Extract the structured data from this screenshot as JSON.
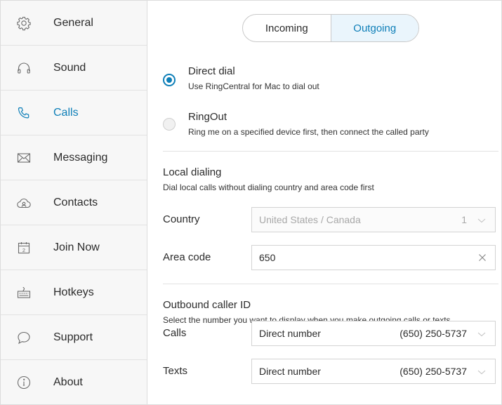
{
  "sidebar": {
    "items": [
      {
        "label": "General",
        "icon": "gear-icon",
        "active": false
      },
      {
        "label": "Sound",
        "icon": "headphones-icon",
        "active": false
      },
      {
        "label": "Calls",
        "icon": "phone-icon",
        "active": true
      },
      {
        "label": "Messaging",
        "icon": "envelope-icon",
        "active": false
      },
      {
        "label": "Contacts",
        "icon": "cloud-contacts-icon",
        "active": false
      },
      {
        "label": "Join Now",
        "icon": "calendar-icon",
        "active": false
      },
      {
        "label": "Hotkeys",
        "icon": "keyboard-icon",
        "active": false
      },
      {
        "label": "Support",
        "icon": "chat-bubble-icon",
        "active": false
      },
      {
        "label": "About",
        "icon": "info-icon",
        "active": false
      }
    ],
    "calendar_day": "2"
  },
  "tabs": {
    "incoming": "Incoming",
    "outgoing": "Outgoing",
    "active": "Outgoing"
  },
  "dial_options": {
    "direct_dial": {
      "title": "Direct dial",
      "desc": "Use RingCentral for Mac to dial out",
      "selected": true
    },
    "ringout": {
      "title": "RingOut",
      "desc": "Ring me on a specified device first, then connect the called party",
      "selected": false
    }
  },
  "local_dialing": {
    "title": "Local dialing",
    "desc": "Dial local calls without dialing country and area code first",
    "country_label": "Country",
    "country_value": "United States / Canada",
    "country_code": "1",
    "area_code_label": "Area code",
    "area_code_value": "650"
  },
  "caller_id": {
    "title": "Outbound caller ID",
    "desc": "Select the number you want to display when you make outgoing calls or texts.",
    "calls_label": "Calls",
    "calls_type": "Direct number",
    "calls_number": "(650) 250-5737",
    "texts_label": "Texts",
    "texts_type": "Direct number",
    "texts_number": "(650) 250-5737"
  },
  "colors": {
    "accent": "#0e7fb8",
    "sidebar_bg": "#f7f7f7",
    "active_tab_bg": "#eaf5fc"
  }
}
